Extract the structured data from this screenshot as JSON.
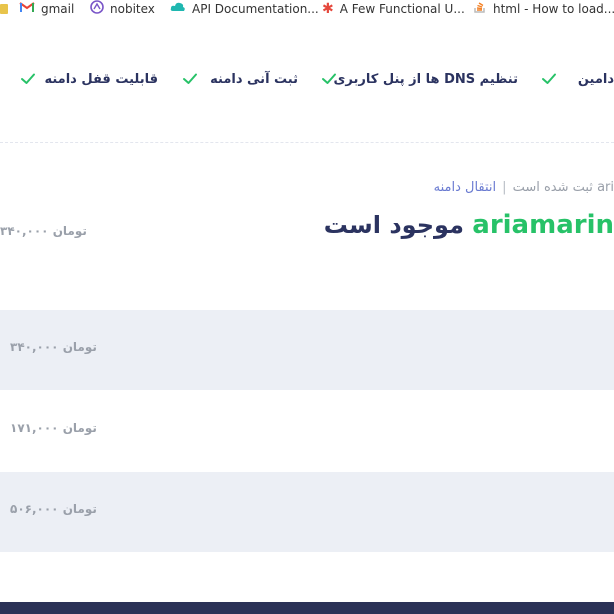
{
  "bookmarks": [
    {
      "label": "gmail",
      "icon": "gmail-icon"
    },
    {
      "label": "nobitex",
      "icon": "nobitex-icon"
    },
    {
      "label": "API Documentation...",
      "icon": "cloud-icon"
    },
    {
      "label": "A Few Functional U...",
      "icon": "asterisk-icon"
    },
    {
      "label": "html - How to load...",
      "icon": "stackoverflow-icon"
    }
  ],
  "features": [
    {
      "label": "دامین"
    },
    {
      "label": "تنظیم DNS ها از پنل کاربری"
    },
    {
      "label": "ثبت آنی دامنه"
    },
    {
      "label": "قابلیت قفل دامنه"
    }
  ],
  "status": {
    "registered_text": "ari ثبت شده است",
    "separator": "|",
    "transfer_link": "انتقال دامنه"
  },
  "headline": {
    "domain": "ariamarin",
    "available": " موجود است"
  },
  "main_price": "۳۴۰,۰۰۰ تومان",
  "rows": [
    {
      "price": "۳۴۰,۰۰۰ تومان"
    },
    {
      "price": "۱۷۱,۰۰۰ تومان"
    },
    {
      "price": "۵۰۶,۰۰۰ تومان"
    }
  ],
  "colors": {
    "accent_green": "#27c268",
    "navy": "#2b3360",
    "link_blue": "#6a7bd1",
    "row_alt": "#eceff5",
    "footer": "#2b3257"
  }
}
